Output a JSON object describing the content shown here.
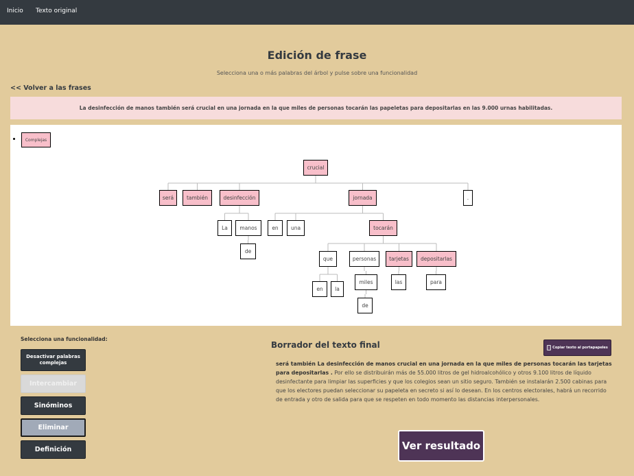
{
  "nav": {
    "home_label": "Inicio",
    "original_label": "Texto original"
  },
  "header": {
    "title": "Edición de frase",
    "subtitle": "Selecciona una o más palabras del árbol y pulse sobre una funcionalidad",
    "back_label": "<< Volver a las frases"
  },
  "sentence": "La desinfección de manos también será crucial en una jornada en la que miles de personas tocarán las papeletas para depositarlas en las 9.000 urnas habilitadas.",
  "tree": {
    "badge_label": "Complejas",
    "badge_color": "#f8bfca",
    "nodes": [
      {
        "id": "crucial",
        "label": "crucial",
        "pink": true
      },
      {
        "id": "sera",
        "label": "será",
        "pink": true
      },
      {
        "id": "tambien",
        "label": "también",
        "pink": true
      },
      {
        "id": "desinfeccion",
        "label": "desinfección",
        "pink": true
      },
      {
        "id": "jornada",
        "label": "jornada",
        "pink": true
      },
      {
        "id": "punto",
        "label": ".",
        "pink": false
      },
      {
        "id": "la1",
        "label": "La",
        "pink": false
      },
      {
        "id": "manos",
        "label": "manos",
        "pink": false
      },
      {
        "id": "en1",
        "label": "en",
        "pink": false
      },
      {
        "id": "una",
        "label": "una",
        "pink": false
      },
      {
        "id": "tocaran",
        "label": "tocarán",
        "pink": true
      },
      {
        "id": "de1",
        "label": "de",
        "pink": false
      },
      {
        "id": "que",
        "label": "que",
        "pink": false
      },
      {
        "id": "personas",
        "label": "personas",
        "pink": false
      },
      {
        "id": "tarjetas",
        "label": "tarjetas",
        "pink": true
      },
      {
        "id": "depositarlas",
        "label": "depositarlas",
        "pink": true
      },
      {
        "id": "en2",
        "label": "en",
        "pink": false
      },
      {
        "id": "la2",
        "label": "la",
        "pink": false
      },
      {
        "id": "miles",
        "label": "miles",
        "pink": false
      },
      {
        "id": "las",
        "label": "las",
        "pink": false
      },
      {
        "id": "para",
        "label": "para",
        "pink": false
      },
      {
        "id": "de2",
        "label": "de",
        "pink": false
      }
    ]
  },
  "functions": {
    "label": "Selecciona una funcionalidad:",
    "buttons": [
      {
        "label": "Desactivar palabras complejas",
        "state": "dark"
      },
      {
        "label": "Intercambiar",
        "state": "disabled"
      },
      {
        "label": "Sinóminos",
        "state": "dark"
      },
      {
        "label": "Eliminar",
        "state": "active"
      },
      {
        "label": "Definición",
        "state": "dark"
      }
    ]
  },
  "draft": {
    "title": "Borrador del texto final",
    "copy_label": "Copiar texto al portapapeles",
    "bold_text": "será también La desinfección de manos crucial en una jornada en la que miles de personas tocarán las tarjetas para depositarlas .",
    "rest_text": " Por ello se distribuirán más de 55.000 litros de gel hidroalcohólico y otros 9.100 litros de líquido desinfectante para limpiar las superficies y que los colegios sean un sitio seguro. También se instalarán 2.500 cabinas para que los electores puedan seleccionar su papeleta en secreto si así lo desean. En los centros electorales, habrá un recorrido de entrada y otro de salida para que se respeten en todo momento las distancias interpersonales."
  },
  "result_label": "Ver resultado",
  "colors": {
    "navbar": "#343a40",
    "background": "#e2cb9c",
    "sentence_bg": "#f7dcdc",
    "pink_node": "#f8bfca",
    "accent_purple": "#4e3456"
  }
}
